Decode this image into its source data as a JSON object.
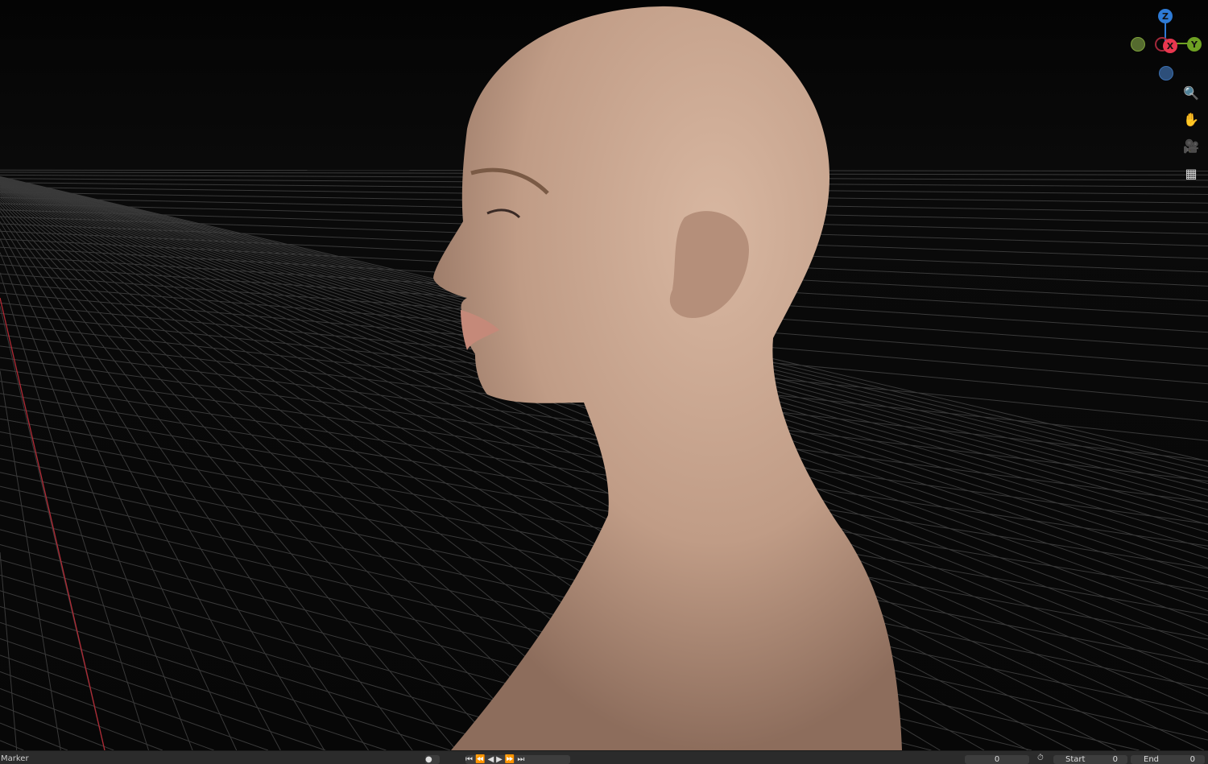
{
  "gizmo": {
    "z": "Z",
    "x": "X",
    "y": "Y",
    "colors": {
      "x": "#e8374f",
      "y": "#6ea123",
      "z": "#2e7bd6"
    }
  },
  "tools": [
    {
      "name": "zoom-icon",
      "glyph": "🔍"
    },
    {
      "name": "hand-icon",
      "glyph": "✋"
    },
    {
      "name": "camera-icon",
      "glyph": "🎥"
    },
    {
      "name": "grid-icon",
      "glyph": "▦"
    }
  ],
  "timeline": {
    "marker_label": "Marker",
    "current_frame": "0",
    "start_label": "Start",
    "start_value": "0",
    "end_label": "End",
    "end_value": "0"
  }
}
